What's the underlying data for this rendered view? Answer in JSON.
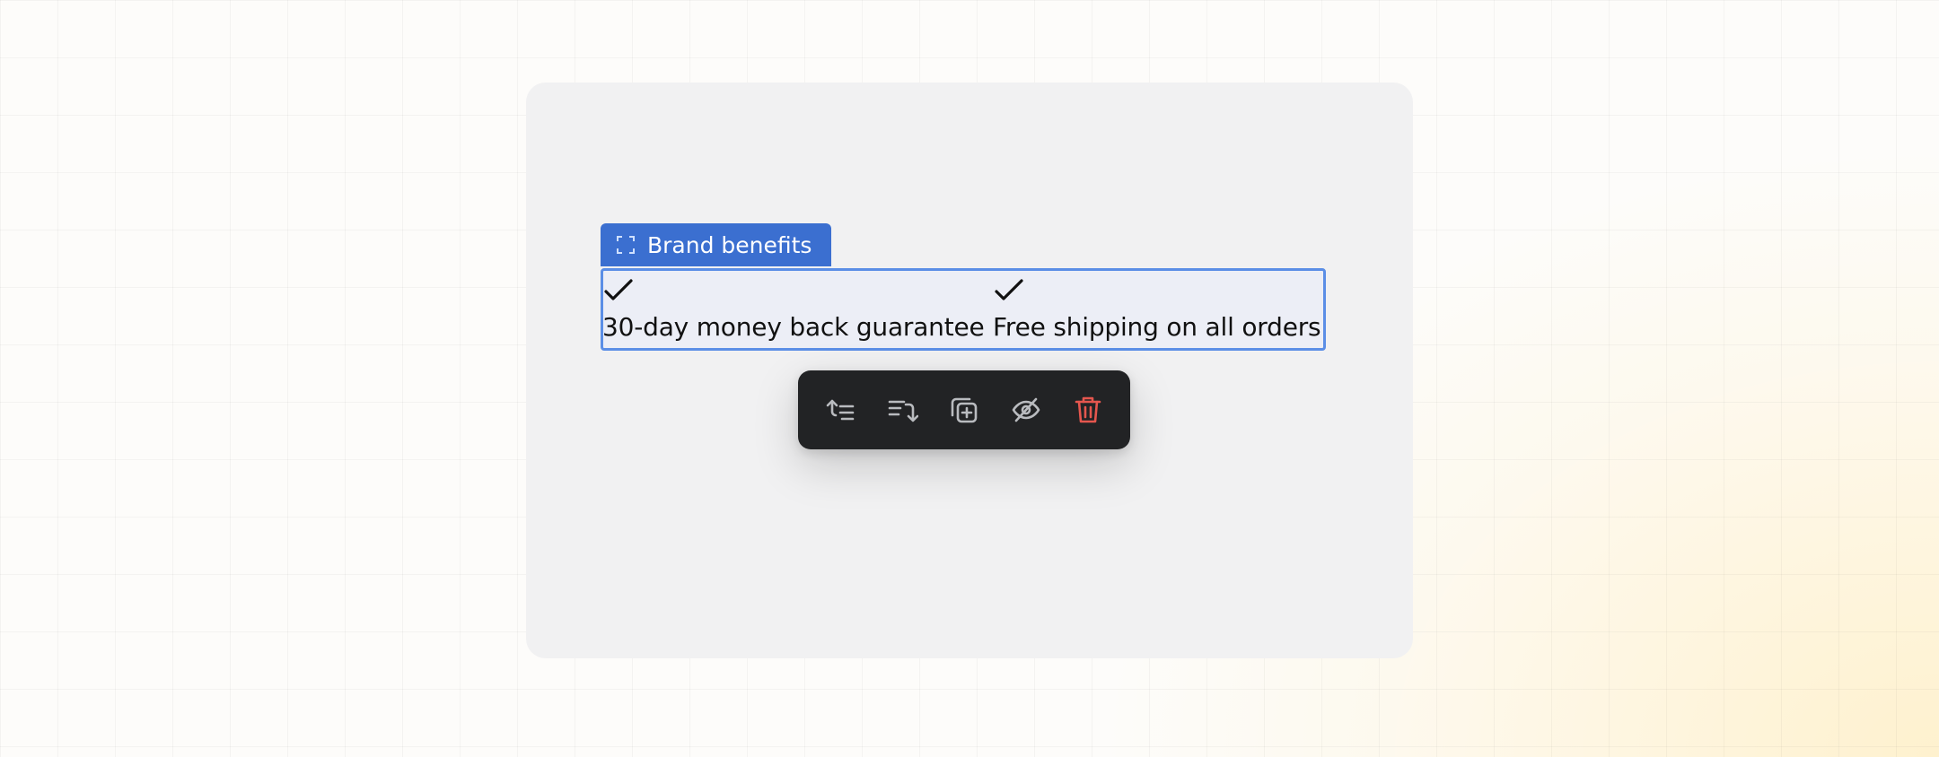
{
  "block": {
    "tag_label": "Brand benefits",
    "tag_icon": "frame-select-icon",
    "accent_color": "#3b6fd0"
  },
  "benefits": [
    {
      "icon": "checkmark-icon",
      "label": "30-day money back guarantee"
    },
    {
      "icon": "checkmark-icon",
      "label": "Free shipping on all orders"
    }
  ],
  "toolbar": {
    "actions": [
      {
        "name": "move-up",
        "icon": "move-up-icon"
      },
      {
        "name": "move-down",
        "icon": "move-down-icon"
      },
      {
        "name": "duplicate",
        "icon": "duplicate-icon"
      },
      {
        "name": "hide",
        "icon": "eye-off-icon"
      },
      {
        "name": "delete",
        "icon": "trash-icon",
        "color": "#e5564e"
      }
    ]
  }
}
